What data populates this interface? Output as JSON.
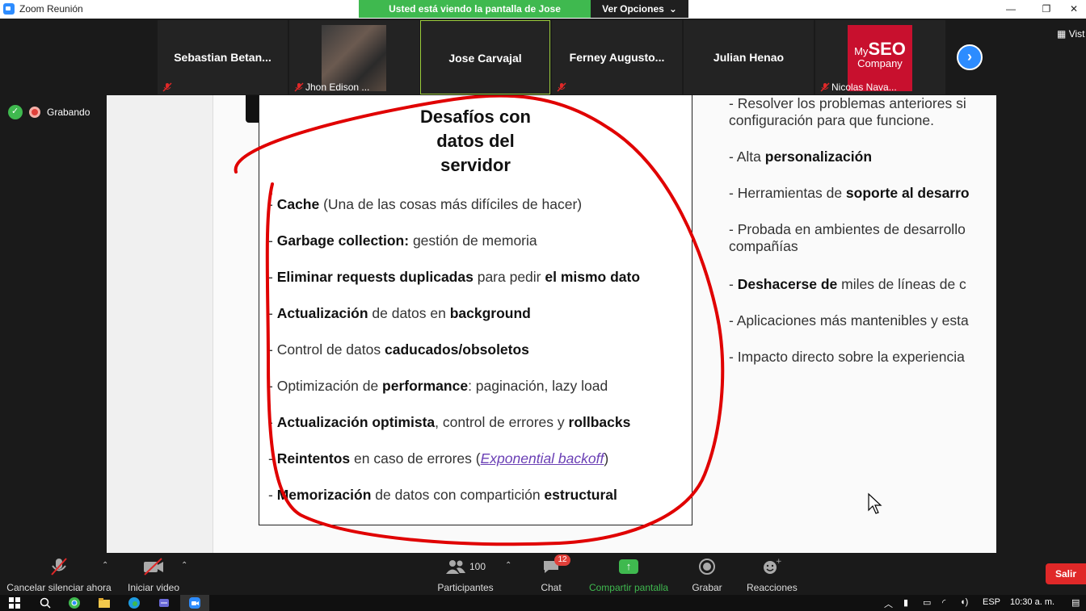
{
  "window": {
    "title": "Zoom Reunión",
    "minimize": "—",
    "restore": "❐",
    "close": "✕"
  },
  "share_banner": {
    "text": "Usted está viendo la pantalla de Jose Carvajal",
    "options": "Ver Opciones",
    "options_caret": "⌄"
  },
  "participants_strip": [
    {
      "name": "Sebastian  Betan...",
      "muted": true
    },
    {
      "name": "Jhon Edison ...",
      "muted": true,
      "has_video": true
    },
    {
      "name": "Jose Carvajal",
      "muted": false,
      "active": true
    },
    {
      "name": "Ferney  Augusto...",
      "muted": true
    },
    {
      "name": "Julian Henao",
      "muted": false
    },
    {
      "name": "Nicolas Nava...",
      "muted": true,
      "logo_top": "My",
      "logo_big": "SEO",
      "logo_bottom": "Company"
    }
  ],
  "strip_next": "›",
  "view_button": "Vist",
  "status": {
    "recording": "Grabando"
  },
  "slide": {
    "box_title": [
      "Desafíos con",
      "datos del",
      "servidor"
    ],
    "bullets": [
      {
        "pre": "- ",
        "b1": "Cache",
        "t1": " (Una de las cosas más difíciles de hacer)"
      },
      {
        "pre": "- ",
        "b1": "Garbage collection:",
        "t1": " gestión de memoria"
      },
      {
        "pre": "- ",
        "b1": "Eliminar requests duplicadas",
        "t1": " para pedir ",
        "b2": "el mismo dato"
      },
      {
        "pre": "- ",
        "b1": "Actualización",
        "t1": " de datos en ",
        "b2": "background"
      },
      {
        "pre": "- ",
        "t0": "Control de datos ",
        "b1": "caducados/obsoletos"
      },
      {
        "pre": "- ",
        "t0": "Optimización de ",
        "b1": "performance",
        "t1": ": paginación, lazy load"
      },
      {
        "pre": "- ",
        "b1": "Actualización optimista",
        "t1": ", control de errores y ",
        "b2": "rollbacks"
      },
      {
        "pre": "- ",
        "b1": "Reintentos",
        "t1": " en caso de errores (",
        "link": "Exponential backoff",
        "t2": ")"
      },
      {
        "pre": "- ",
        "b1": "Memorización",
        "t1": " de datos con compartición ",
        "b2": "estructural"
      }
    ],
    "right_items": [
      {
        "t0": "- Resolver los problemas anteriores si",
        "line2": "configuración para que funcione."
      },
      {
        "t0": "- Alta ",
        "b1": "personalización"
      },
      {
        "t0": "- Herramientas de ",
        "b1": "soporte al desarro"
      },
      {
        "t0": "- Probada en ambientes de desarrollo",
        "line2": "compañías"
      },
      {
        "t0": "- ",
        "b1": "Deshacerse de",
        "t1": " miles de líneas de c"
      },
      {
        "t0": "- Aplicaciones más mantenibles y esta"
      },
      {
        "t0": "- Impacto directo sobre la experiencia"
      }
    ]
  },
  "toolbar": {
    "unmute": "Cancelar silenciar ahora",
    "start_video": "Iniciar video",
    "participants": "Participantes",
    "participants_count": "100",
    "chat": "Chat",
    "chat_badge": "12",
    "share": "Compartir pantalla",
    "record": "Grabar",
    "reactions": "Reacciones",
    "leave": "Salir"
  },
  "taskbar": {
    "language": "ESP",
    "time": "10:30 a. m."
  },
  "colors": {
    "zoom_blue": "#2d8cff",
    "green": "#3fb94f",
    "red": "#e02828",
    "annotation": "#e00000"
  }
}
